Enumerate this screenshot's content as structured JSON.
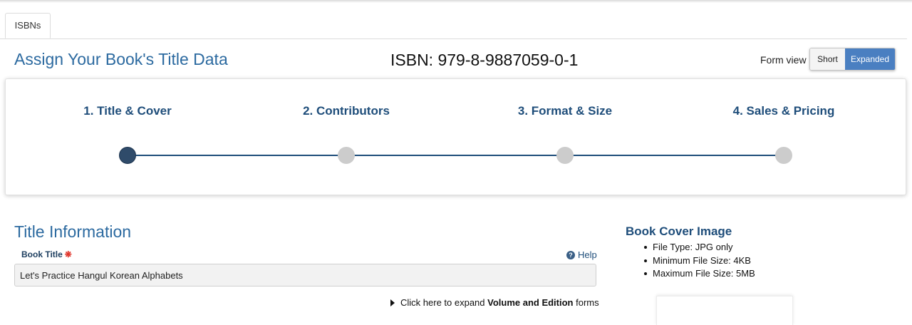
{
  "tabs": [
    {
      "label": "ISBNs"
    }
  ],
  "header": {
    "title": "Assign Your Book's Title Data",
    "isbn": "ISBN: 979-8-9887059-0-1",
    "form_view_label": "Form view",
    "form_view_options": [
      "Short",
      "Expanded"
    ],
    "form_view_selected": "Expanded"
  },
  "steps": [
    {
      "label": "1. Title & Cover",
      "status": "active"
    },
    {
      "label": "2. Contributors",
      "status": "inactive"
    },
    {
      "label": "3. Format & Size",
      "status": "inactive"
    },
    {
      "label": "4. Sales & Pricing",
      "status": "inactive"
    }
  ],
  "title_info": {
    "heading": "Title Information",
    "book_title_label": "Book Title",
    "required_mark": "❋",
    "help_label": "Help",
    "book_title_value": "Let's Practice Hangul Korean Alphabets",
    "expand_prefix": "Click here to expand ",
    "expand_bold": "Volume and Edition",
    "expand_suffix": " forms"
  },
  "cover": {
    "heading": "Book Cover Image",
    "requirements": [
      "File Type: JPG only",
      "Minimum File Size: 4KB",
      "Maximum File Size: 5MB"
    ]
  },
  "colors": {
    "title_blue": "#2c6aa0",
    "step_navy": "#1e4d7a",
    "toggle_active": "#4a7fc1",
    "required_red": "#e0352b"
  }
}
